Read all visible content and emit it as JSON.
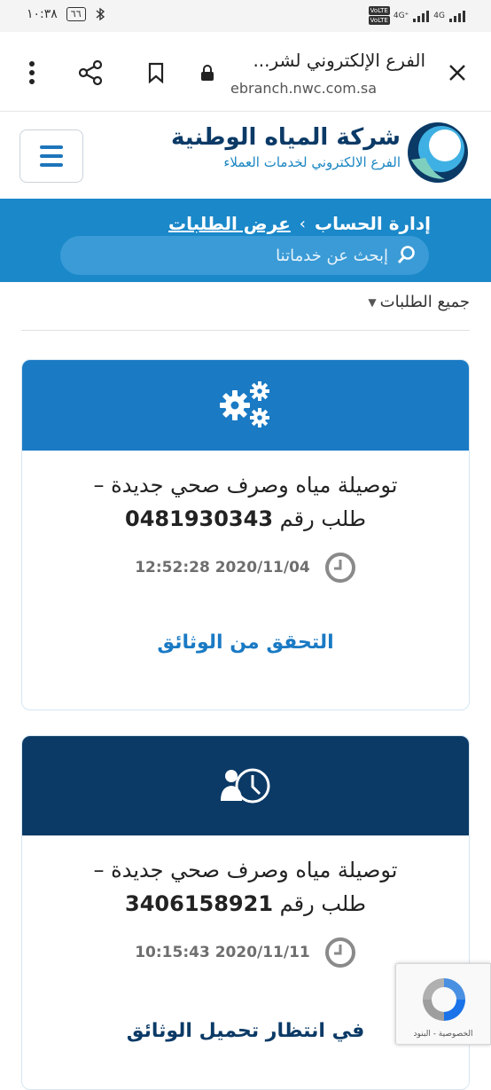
{
  "status_bar": {
    "time": "١٠:٣٨",
    "battery": "٦٦",
    "signal1": "4G",
    "signal2": "4G⁺",
    "volte": "VoLTE"
  },
  "browser": {
    "page_title": "الفرع الإلكتروني لشر...",
    "url": "ebranch.nwc.com.sa",
    "icons": [
      "close-icon",
      "lock-icon",
      "bookmark-icon",
      "share-icon",
      "more-vert-icon"
    ]
  },
  "site_header": {
    "logo_main": "شركة المياه الوطنية",
    "logo_sub": "الفرع الالكتروني لخدمات العملاء"
  },
  "breadcrumb": {
    "items": [
      "إدارة الحساب",
      "عرض الطلبات"
    ],
    "separator": "›"
  },
  "search": {
    "placeholder": "إبحث عن خدماتنا"
  },
  "filter": {
    "label": "جميع الطلبات"
  },
  "requests": [
    {
      "title_line1": "توصيلة مياه وصرف صحي جديدة –",
      "title_prefix": "طلب رقم",
      "number": "0481930343",
      "timestamp": "12:52:28 2020/11/04",
      "action": "التحقق من الوثائق",
      "icon": "gears-icon",
      "color": "#1a7ac4"
    },
    {
      "title_line1": "توصيلة مياه وصرف صحي جديدة –",
      "title_prefix": "طلب رقم",
      "number": "3406158921",
      "timestamp": "10:15:43 2020/11/11",
      "action": "في انتظار تحميل الوثائق",
      "icon": "user-clock-icon",
      "color": "#0b3a66"
    }
  ],
  "recaptcha": {
    "links": "الخصوصية - البنود"
  }
}
